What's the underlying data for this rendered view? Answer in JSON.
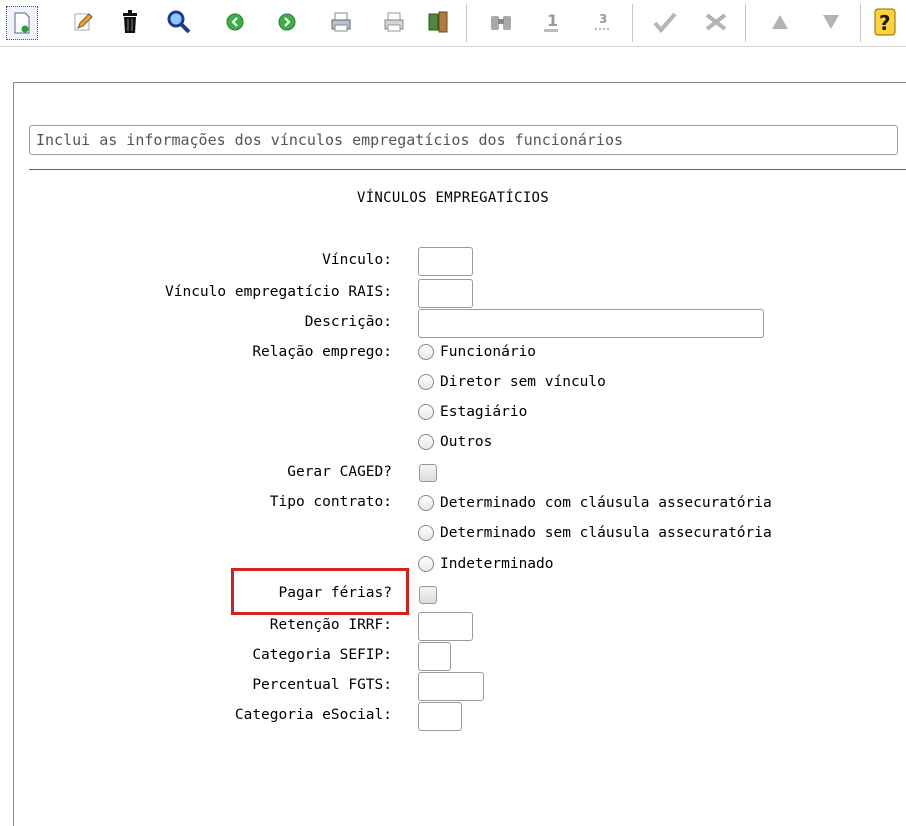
{
  "toolbar": {
    "icons": [
      "new-document-icon",
      "edit-pencil-icon",
      "trash-icon",
      "search-magnifier-icon",
      "previous-circle-icon",
      "next-circle-icon",
      "print-icon",
      "print-preview-icon",
      "export-icon",
      "binoculars-icon",
      "sort-ascending-icon",
      "sort-descending-icon",
      "check-icon",
      "tools-icon",
      "move-up-icon",
      "move-down-icon",
      "help-icon"
    ]
  },
  "description_bar": "Inclui as informações dos vínculos empregatícios dos funcionários",
  "form": {
    "title": "VÍNCULOS EMPREGATÍCIOS",
    "vinculo_label": "Vínculo:",
    "vinculo_rais_label": "Vínculo empregatício RAIS:",
    "descricao_label": "Descrição:",
    "relacao_label": "Relação emprego:",
    "relacao_options": [
      "Funcionário",
      "Diretor sem vínculo",
      "Estagiário",
      "Outros"
    ],
    "gerar_caged_label": "Gerar CAGED?",
    "tipo_contrato_label": "Tipo contrato:",
    "tipo_contrato_options": [
      "Determinado com cláusula assecuratória",
      "Determinado sem cláusula assecuratória",
      "Indeterminado"
    ],
    "pagar_ferias_label": "Pagar férias?",
    "retencao_irrf_label": "Retenção IRRF:",
    "categoria_sefip_label": "Categoria SEFIP:",
    "percentual_fgts_label": "Percentual FGTS:",
    "categoria_esocial_label": "Categoria eSocial:"
  },
  "colors": {
    "highlight": "#d9221c",
    "separator": "#c0392b"
  }
}
